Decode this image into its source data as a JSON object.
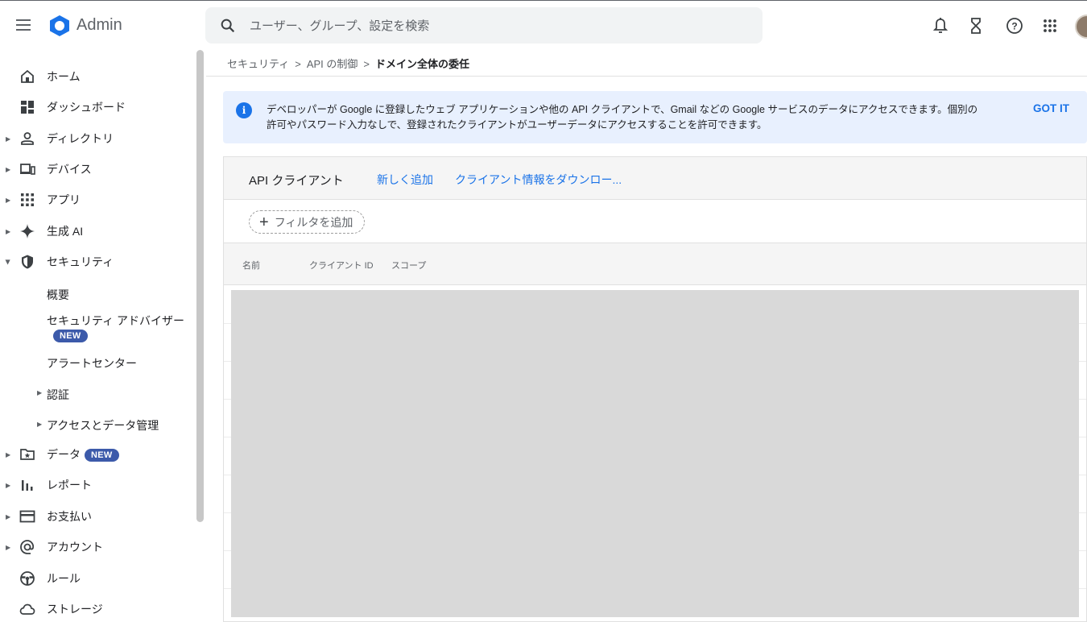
{
  "app": {
    "title": "Admin",
    "search_placeholder": "ユーザー、グループ、設定を検索",
    "icons": [
      "menu-icon",
      "admin-logo-icon",
      "search-icon",
      "notification-bell-icon",
      "hourglass-icon",
      "help-icon",
      "apps-grid-icon",
      "avatar"
    ]
  },
  "sidebar": {
    "items": [
      {
        "label": "ホーム",
        "icon": "home-icon"
      },
      {
        "label": "ダッシュボード",
        "icon": "dashboard-icon"
      },
      {
        "label": "ディレクトリ",
        "icon": "person-icon"
      },
      {
        "label": "デバイス",
        "icon": "devices-icon"
      },
      {
        "label": "アプリ",
        "icon": "apps-icon"
      },
      {
        "label": "生成 AI",
        "icon": "sparkle-icon"
      },
      {
        "label": "セキュリティ",
        "icon": "shield-icon"
      },
      {
        "label": "データ",
        "icon": "data-folder-icon",
        "badge": "NEW"
      },
      {
        "label": "レポート",
        "icon": "bar-chart-icon"
      },
      {
        "label": "お支払い",
        "icon": "credit-card-icon"
      },
      {
        "label": "アカウント",
        "icon": "at-sign-icon"
      },
      {
        "label": "ルール",
        "icon": "steering-icon"
      },
      {
        "label": "ストレージ",
        "icon": "cloud-icon"
      }
    ],
    "security_sub": {
      "overview": "概要",
      "advisor": "セキュリティ アドバイザー",
      "advisor_badge": "NEW",
      "alert_center": "アラートセンター",
      "auth": "認証",
      "access_data": "アクセスとデータ管理"
    }
  },
  "breadcrumb": {
    "item1": "セキュリティ",
    "item2": "API の制御",
    "current": "ドメイン全体の委任",
    "separator": ">"
  },
  "info_banner": {
    "line1": "デベロッパーが Google に登録したウェブ アプリケーションや他の API クライアントで、Gmail などの Google サービスのデータにアクセスできます。個別の",
    "line2": "許可やパスワード入力なしで、登録されたクライアントがユーザーデータにアクセスすることを許可できます。",
    "action": "GOT IT",
    "icon_glyph": "i"
  },
  "api_clients": {
    "title": "API クライアント",
    "add_new": "新しく追加",
    "download": "クライアント情報をダウンロー...",
    "filter_label": "フィルタを追加",
    "filter_plus": "+",
    "columns": {
      "name": "名前",
      "client_id": "クライアント ID",
      "scope": "スコープ"
    }
  },
  "colors": {
    "accent": "#1a73e8",
    "badge": "#3c5aaa",
    "banner_bg": "#e8f0fe",
    "redacted": "#d9d9d9"
  }
}
